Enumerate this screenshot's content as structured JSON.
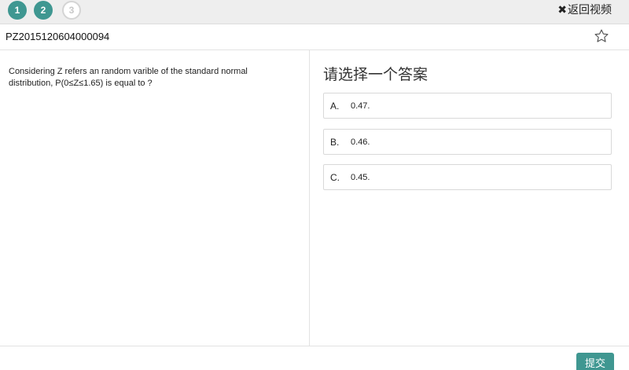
{
  "steps": [
    {
      "label": "1",
      "state": "done"
    },
    {
      "label": "2",
      "state": "done"
    },
    {
      "label": "3",
      "state": "todo"
    }
  ],
  "header": {
    "back_icon": "close-icon",
    "back_label": "返回视频"
  },
  "question": {
    "id": "PZ2015120604000094",
    "favorite_icon": "star-outline-icon",
    "text": "Considering Z refers an random varible of the standard normal distribution, P(0≤Z≤1.65) is equal to ?"
  },
  "answers": {
    "prompt": "请选择一个答案",
    "options": [
      {
        "letter": "A.",
        "value": "0.47."
      },
      {
        "letter": "B.",
        "value": "0.46."
      },
      {
        "letter": "C.",
        "value": "0.45."
      }
    ]
  },
  "footer": {
    "submit_label": "提交"
  },
  "colors": {
    "accent": "#3f9791",
    "step_todo_border": "#d4d4d4",
    "topbar_bg": "#eeeeee"
  }
}
